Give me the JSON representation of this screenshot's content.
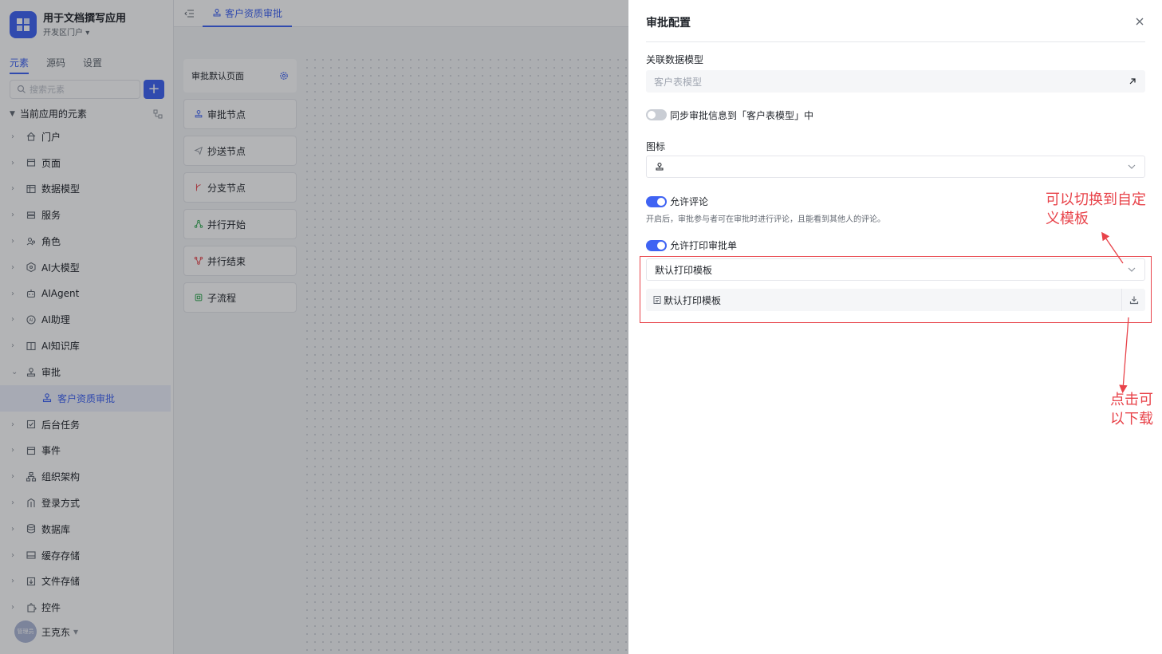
{
  "app": {
    "name": "用于文档撰写应用",
    "portal": "开发区门户"
  },
  "sidebar": {
    "tabs": [
      {
        "label": "元素"
      },
      {
        "label": "源码"
      },
      {
        "label": "设置"
      }
    ],
    "search_placeholder": "搜索元素",
    "add_label": "+",
    "tree_title": "当前应用的元素",
    "items": [
      {
        "label": "门户",
        "icon": "home-icon"
      },
      {
        "label": "页面",
        "icon": "page-icon"
      },
      {
        "label": "数据模型",
        "icon": "table-icon"
      },
      {
        "label": "服务",
        "icon": "service-icon"
      },
      {
        "label": "角色",
        "icon": "role-icon"
      },
      {
        "label": "AI大模型",
        "icon": "ai-model-icon"
      },
      {
        "label": "AIAgent",
        "icon": "robot-icon"
      },
      {
        "label": "AI助理",
        "icon": "ai-assistant-icon"
      },
      {
        "label": "AI知识库",
        "icon": "book-icon"
      },
      {
        "label": "审批",
        "icon": "stamp-icon",
        "expanded": true
      },
      {
        "label": "客户资质审批",
        "icon": "stamp-icon",
        "child": true,
        "selected": true
      },
      {
        "label": "后台任务",
        "icon": "task-icon"
      },
      {
        "label": "事件",
        "icon": "event-icon"
      },
      {
        "label": "组织架构",
        "icon": "org-icon"
      },
      {
        "label": "登录方式",
        "icon": "login-icon"
      },
      {
        "label": "数据库",
        "icon": "database-icon"
      },
      {
        "label": "缓存存储",
        "icon": "cache-icon"
      },
      {
        "label": "文件存储",
        "icon": "file-icon"
      },
      {
        "label": "控件",
        "icon": "puzzle-icon"
      }
    ],
    "user": {
      "name": "王克东",
      "avatar_text": "管理员"
    }
  },
  "topbar": {
    "current_tab": "客户资质审批"
  },
  "canvas": {
    "default_page_label": "审批默认页面",
    "nodes": [
      {
        "label": "审批节点",
        "icon": "stamp-icon",
        "color": "#3f63f3"
      },
      {
        "label": "抄送节点",
        "icon": "send-icon",
        "color": "#8f959e"
      },
      {
        "label": "分支节点",
        "icon": "branch-icon",
        "color": "#e8434a"
      },
      {
        "label": "并行开始",
        "icon": "parallel-start-icon",
        "color": "#2fa84f"
      },
      {
        "label": "并行结束",
        "icon": "parallel-end-icon",
        "color": "#e8434a"
      },
      {
        "label": "子流程",
        "icon": "subprocess-icon",
        "color": "#2fa84f"
      }
    ]
  },
  "drawer": {
    "title": "审批配置",
    "model_label": "关联数据模型",
    "model_value": "客户表模型",
    "sync_label": "同步审批信息到「客户表模型」中",
    "sync_on": false,
    "icon_label": "图标",
    "allow_comment_label": "允许评论",
    "allow_comment_on": true,
    "comment_hint": "开启后，审批参与者可在审批时进行评论，且能看到其他人的评论。",
    "allow_print_label": "允许打印审批单",
    "allow_print_on": true,
    "print_template_select": "默认打印模板",
    "print_template_file": "默认打印模板"
  },
  "annotations": {
    "switch_note_line1": "可以切换到自定",
    "switch_note_line2": "义模板",
    "download_note_line1": "点击可",
    "download_note_line2": "以下载",
    "color": "#e8434a"
  },
  "colors": {
    "accent": "#3f63f3",
    "annotation": "#e8434a"
  }
}
